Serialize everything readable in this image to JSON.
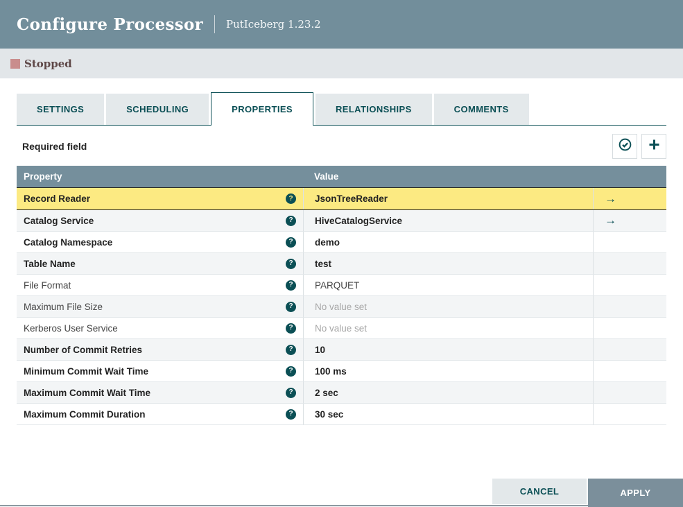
{
  "dialog": {
    "title": "Configure Processor",
    "subtitle": "PutIceberg 1.23.2"
  },
  "status": {
    "label": "Stopped",
    "square_color": "#c98d8d"
  },
  "tabs": [
    {
      "label": "SETTINGS",
      "active": false
    },
    {
      "label": "SCHEDULING",
      "active": false
    },
    {
      "label": "PROPERTIES",
      "active": true
    },
    {
      "label": "RELATIONSHIPS",
      "active": false
    },
    {
      "label": "COMMENTS",
      "active": false
    }
  ],
  "toolbar": {
    "required_label": "Required field",
    "verify_button": "verify-properties-icon",
    "add_button": "add-property-icon"
  },
  "table": {
    "columns": {
      "property": "Property",
      "value": "Value"
    },
    "help_icon_glyph": "?",
    "goto_icon_glyph": "→",
    "rows": [
      {
        "property": "Record Reader",
        "value": "JsonTreeReader",
        "required": true,
        "unset": false,
        "selected": true,
        "has_goto": true
      },
      {
        "property": "Catalog Service",
        "value": "HiveCatalogService",
        "required": true,
        "unset": false,
        "selected": false,
        "has_goto": true
      },
      {
        "property": "Catalog Namespace",
        "value": "demo",
        "required": true,
        "unset": false,
        "selected": false,
        "has_goto": false
      },
      {
        "property": "Table Name",
        "value": "test",
        "required": true,
        "unset": false,
        "selected": false,
        "has_goto": false
      },
      {
        "property": "File Format",
        "value": "PARQUET",
        "required": false,
        "unset": false,
        "selected": false,
        "has_goto": false
      },
      {
        "property": "Maximum File Size",
        "value": "No value set",
        "required": false,
        "unset": true,
        "selected": false,
        "has_goto": false
      },
      {
        "property": "Kerberos User Service",
        "value": "No value set",
        "required": false,
        "unset": true,
        "selected": false,
        "has_goto": false
      },
      {
        "property": "Number of Commit Retries",
        "value": "10",
        "required": true,
        "unset": false,
        "selected": false,
        "has_goto": false
      },
      {
        "property": "Minimum Commit Wait Time",
        "value": "100 ms",
        "required": true,
        "unset": false,
        "selected": false,
        "has_goto": false
      },
      {
        "property": "Maximum Commit Wait Time",
        "value": "2 sec",
        "required": true,
        "unset": false,
        "selected": false,
        "has_goto": false
      },
      {
        "property": "Maximum Commit Duration",
        "value": "30 sec",
        "required": true,
        "unset": false,
        "selected": false,
        "has_goto": false
      }
    ]
  },
  "footer": {
    "cancel_label": "CANCEL",
    "apply_label": "APPLY"
  },
  "colors": {
    "header_bg": "#728e9b",
    "accent_teal": "#0b4f55",
    "selected_row_bg": "#fcea82",
    "shade_row_bg": "#f3f5f6",
    "stopped_square": "#c98d8d"
  }
}
